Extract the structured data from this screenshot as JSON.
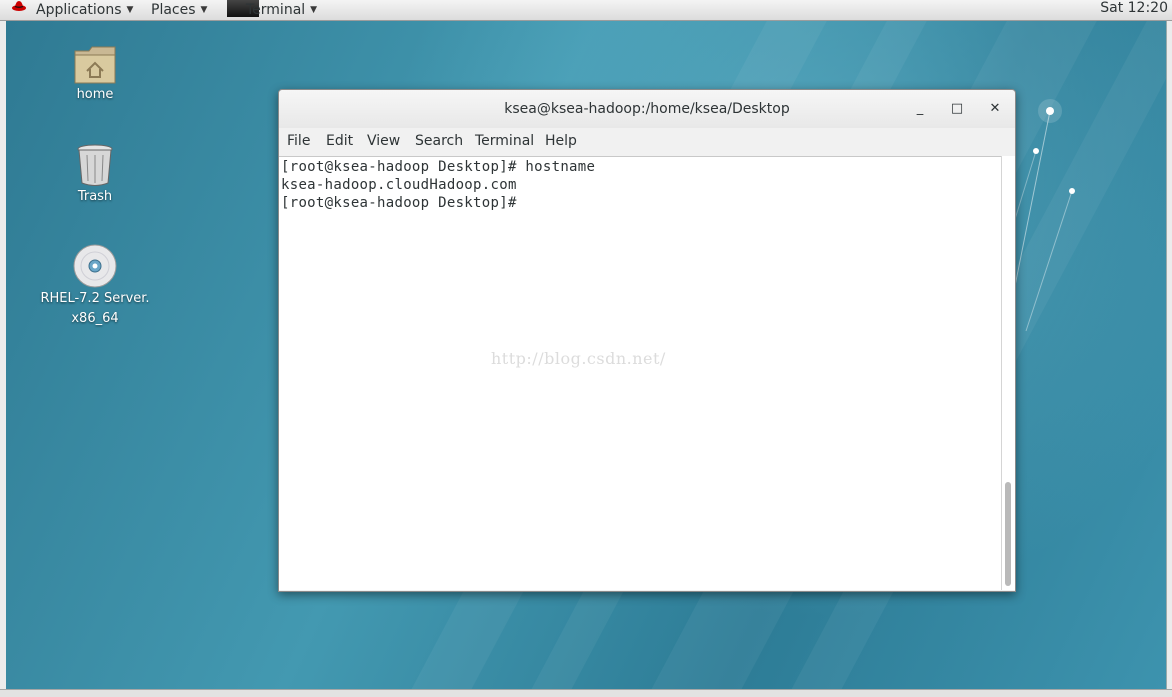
{
  "panel": {
    "applications": "Applications",
    "places": "Places",
    "terminal": "Terminal",
    "clock": "Sat 12:20"
  },
  "desktop": {
    "icons": [
      {
        "label": "home",
        "icon": "folder-home-icon"
      },
      {
        "label": "Trash",
        "icon": "trash-icon"
      },
      {
        "label_line1": "RHEL-7.2 Server.",
        "label_line2": "x86_64",
        "icon": "optical-disc-icon"
      }
    ]
  },
  "window": {
    "title": "ksea@ksea-hadoop:/home/ksea/Desktop",
    "minimize": "_",
    "maximize": "□",
    "close": "✕",
    "menu": [
      "File",
      "Edit",
      "View",
      "Search",
      "Terminal",
      "Help"
    ],
    "lines": [
      "[root@ksea-hadoop Desktop]# hostname",
      "ksea-hadoop.cloudHadoop.com",
      "[root@ksea-hadoop Desktop]#"
    ],
    "watermark": "http://blog.csdn.net/"
  },
  "colors": {
    "desktop": "#3b8fa6",
    "panel": "#e6e6e6",
    "terminal_bg": "#ffffff"
  }
}
